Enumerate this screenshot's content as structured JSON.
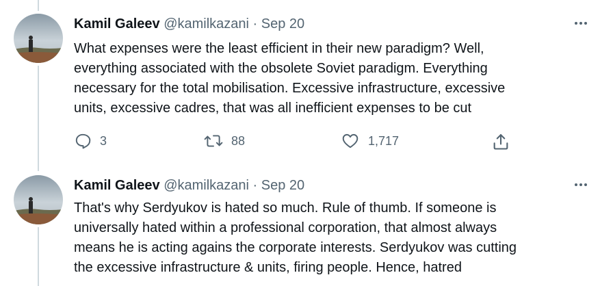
{
  "tweets": [
    {
      "author_name": "Kamil Galeev",
      "handle": "@kamilkazani",
      "separator": "·",
      "date": "Sep 20",
      "text_lines": [
        "What expenses were the least efficient in their new paradigm? Well,",
        "everything associated with the obsolete Soviet paradigm. Everything",
        "necessary for the total mobilisation. Excessive infrastructure, excessive",
        "units, excessive cadres, that was all inefficient expenses to be cut"
      ],
      "replies": "3",
      "retweets": "88",
      "likes": "1,717"
    },
    {
      "author_name": "Kamil Galeev",
      "handle": "@kamilkazani",
      "separator": "·",
      "date": "Sep 20",
      "text_lines": [
        "That's why Serdyukov is hated so much. Rule of thumb. If someone is",
        "universally hated within a professional corporation, that almost always",
        "means he is acting agains the corporate interests. Serdyukov was cutting",
        "the excessive infrastructure & units, firing people. Hence, hatred"
      ]
    }
  ],
  "icons": {
    "reply": "reply-icon",
    "retweet": "retweet-icon",
    "like": "heart-icon",
    "share": "share-icon",
    "more": "more-icon"
  },
  "colors": {
    "text": "#0f1419",
    "secondary": "#536471",
    "thread_line": "#cfd9de"
  }
}
